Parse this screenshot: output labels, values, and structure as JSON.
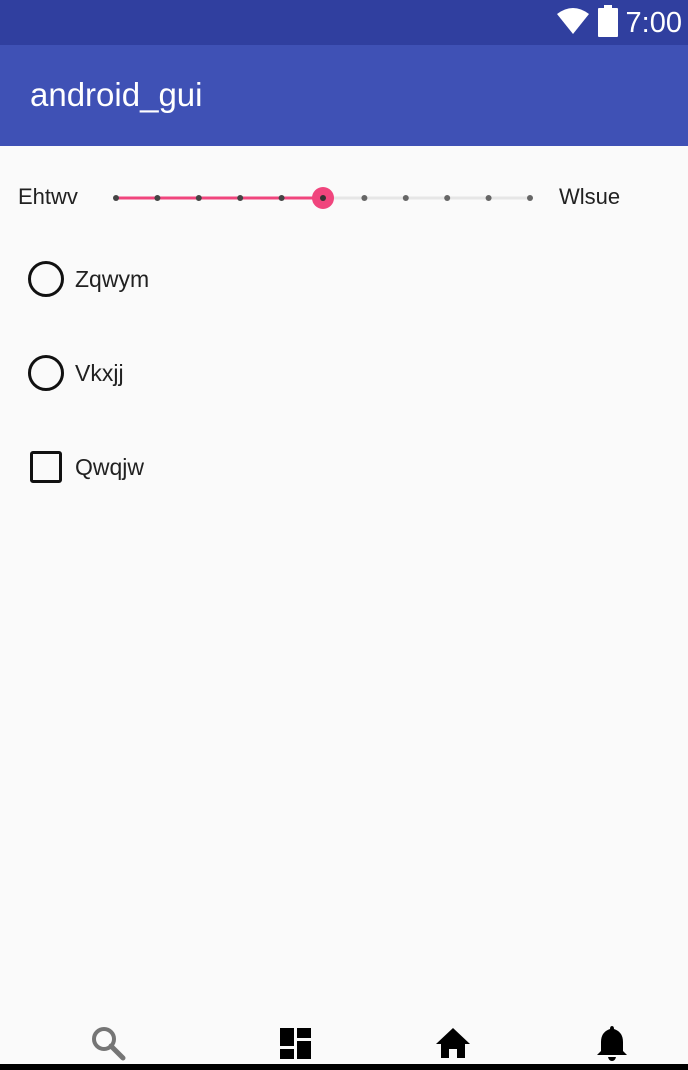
{
  "status_bar": {
    "time": "7:00",
    "icons": [
      "wifi-icon",
      "battery-icon"
    ]
  },
  "app_bar": {
    "title": "android_gui"
  },
  "slider": {
    "left_label": "Ehtwv",
    "right_label": "Wlsue",
    "steps": 10,
    "value": 5,
    "accent_color": "#f0457d"
  },
  "options": [
    {
      "type": "radio",
      "label": "Zqwym",
      "checked": false
    },
    {
      "type": "radio",
      "label": "Vkxjj",
      "checked": false
    },
    {
      "type": "checkbox",
      "label": "Qwqjw",
      "checked": false
    }
  ],
  "bottom_nav": {
    "items": [
      "search-icon",
      "dashboard-icon",
      "home-icon",
      "notifications-icon"
    ]
  },
  "colors": {
    "status_bar": "#303f9f",
    "app_bar": "#3f51b5",
    "background": "#fafafa"
  }
}
